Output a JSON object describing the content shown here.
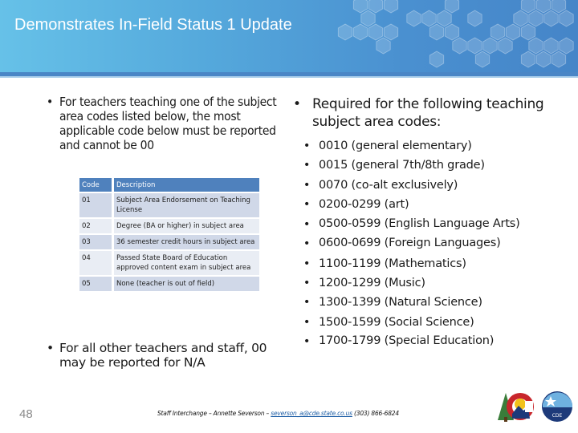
{
  "header": {
    "title": "Demonstrates In-Field Status 1 Update"
  },
  "left": {
    "bullet_main": "For teachers teaching one of the subject area codes listed below, the most applicable code below must be reported and cannot be 00",
    "table": {
      "headers": [
        "Code",
        "Description"
      ],
      "rows": [
        {
          "code": "01",
          "description": "Subject Area Endorsement on Teaching License"
        },
        {
          "code": "02",
          "description": "Degree (BA or higher) in subject area"
        },
        {
          "code": "03",
          "description": "36 semester credit hours in subject area"
        },
        {
          "code": "04",
          "description": "Passed State Board of Education approved content exam in subject area"
        },
        {
          "code": "05",
          "description": "None (teacher is out of field)"
        }
      ]
    },
    "bullet_secondary": "For all other teachers and staff, 00 may be reported for N/A"
  },
  "right": {
    "bullet_main": "Required for the following teaching subject area codes:",
    "codes": [
      "0010 (general elementary)",
      "0015 (general 7th/8th grade)",
      "0070 (co-alt exclusively)",
      "0200-0299 (art)",
      "0500-0599 (English Language Arts)",
      "0600-0699 (Foreign Languages)",
      "1100-1199 (Mathematics)",
      "1200-1299 (Music)",
      "1300-1399 (Natural Science)",
      "1500-1599 (Social Science)",
      "1700-1799 (Special Education)"
    ]
  },
  "footer": {
    "page_number": "48",
    "credit_prefix": "Staff Interchange – Annette Severson – ",
    "email": "severson_a@cde.state.co.us",
    "phone": " (303) 866-6824",
    "logo_state": "colorado-state-logo",
    "logo_cde_text": "CDE"
  },
  "colors": {
    "header_start": "#66c1e8",
    "header_end": "#4585c8",
    "table_header": "#4f81bd",
    "table_row_odd": "#d0d8e8",
    "table_row_even": "#e9edf4",
    "link": "#1f5fa6"
  }
}
